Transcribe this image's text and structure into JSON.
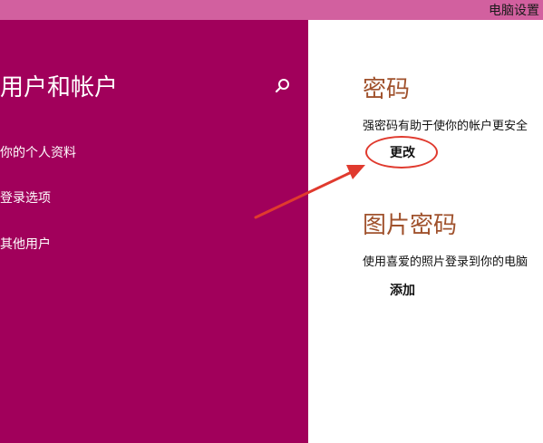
{
  "window": {
    "title": "电脑设置"
  },
  "sidebar": {
    "title": "用户和帐户",
    "search_icon": "search-icon",
    "items": [
      {
        "label": "你的个人资料"
      },
      {
        "label": "登录选项"
      },
      {
        "label": "其他用户"
      }
    ]
  },
  "main": {
    "password": {
      "title": "密码",
      "description": "强密码有助于使你的帐户更安全",
      "button_label": "更改"
    },
    "picture_password": {
      "title": "图片密码",
      "description": "使用喜爱的照片登录到你的电脑",
      "button_label": "添加"
    }
  },
  "colors": {
    "titlebar": "#d2609f",
    "sidebar": "#a1005b",
    "section_title": "#a0522d",
    "annotation": "#e03a2e"
  }
}
